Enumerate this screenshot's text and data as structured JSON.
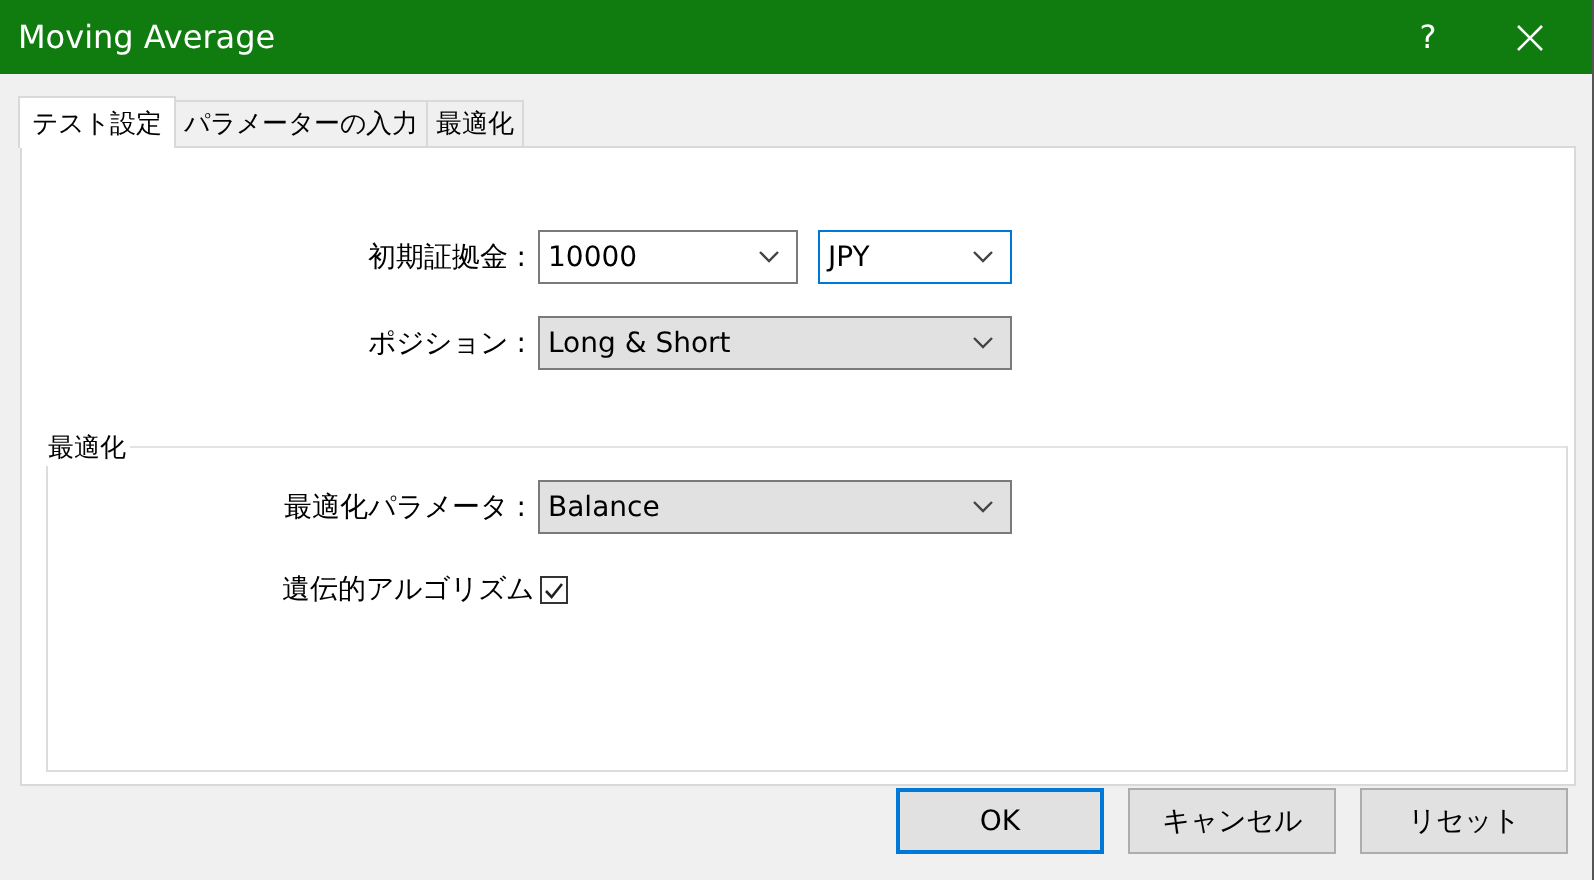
{
  "window": {
    "title": "Moving Average",
    "help": "?"
  },
  "tabs": [
    {
      "label": "テスト設定",
      "selected": true
    },
    {
      "label": "パラメーターの入力",
      "selected": false
    },
    {
      "label": "最適化",
      "selected": false
    }
  ],
  "deposit": {
    "label": "初期証拠金 :",
    "value": "10000",
    "currency": {
      "value": "JPY",
      "focused": true
    }
  },
  "position": {
    "label": "ポジション :",
    "value": "Long & Short"
  },
  "optimization": {
    "title": "最適化",
    "parameter": {
      "label": "最適化パラメータ :",
      "value": "Balance"
    },
    "genetic": {
      "label": "遺伝的アルゴリズム",
      "checked": true
    }
  },
  "buttons": [
    {
      "label": "OK",
      "default": true
    },
    {
      "label": "キャンセル",
      "default": false
    },
    {
      "label": "リセット",
      "default": false
    }
  ]
}
